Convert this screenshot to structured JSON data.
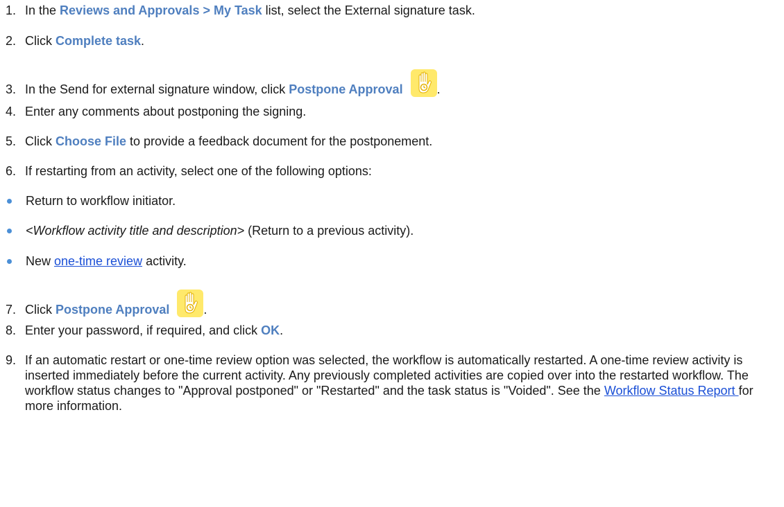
{
  "steps": {
    "s1": {
      "num": "1.",
      "pre": "In the ",
      "strong": "Reviews and Approvals > My Task",
      "post": " list, select the External signature task."
    },
    "s2": {
      "num": "2.",
      "pre": "Click ",
      "strong": "Complete task",
      "post": "."
    },
    "s3": {
      "num": "3.",
      "pre": "In the Send for external signature window, click ",
      "strong": "Postpone Approval",
      "post": "."
    },
    "s4": {
      "num": "4.",
      "text": "Enter any comments about postponing the signing."
    },
    "s5": {
      "num": "5.",
      "pre": "Click ",
      "strong": "Choose File",
      "post": " to provide a feedback document for the postponement."
    },
    "s6": {
      "num": "6.",
      "text": "If restarting from an activity, select one of the following options:"
    },
    "s7": {
      "num": "7.",
      "pre": "Click ",
      "strong": "Postpone Approval",
      "post": "."
    },
    "s8": {
      "num": "8.",
      "pre": "Enter your password, if required, and click ",
      "strong": "OK",
      "post": "."
    },
    "s9": {
      "num": "9.",
      "text": "If an automatic restart or one-time review option was selected, the workflow is automatically restarted. A one-time review activity is inserted immediately before the current activity. Any previously completed activities are copied over into the restarted workflow. The workflow status changes to \"Approval postponed\" or \"Restarted\" and the task status is \"Voided\". See the ",
      "link": "Workflow Status Report ",
      "post": "for more information."
    }
  },
  "options": {
    "o1": {
      "text": "Return to workflow initiator."
    },
    "o2": {
      "italic": "<Workflow activity title and description>",
      "post": " (Return to a previous activity)."
    },
    "o3": {
      "pre": "New ",
      "link": "one-time review",
      "post": " activity."
    }
  },
  "icon": {
    "name": "postpone-approval-icon",
    "bg": "#ffe96b",
    "hand": "#ffffff",
    "accent": "#e5b100"
  }
}
